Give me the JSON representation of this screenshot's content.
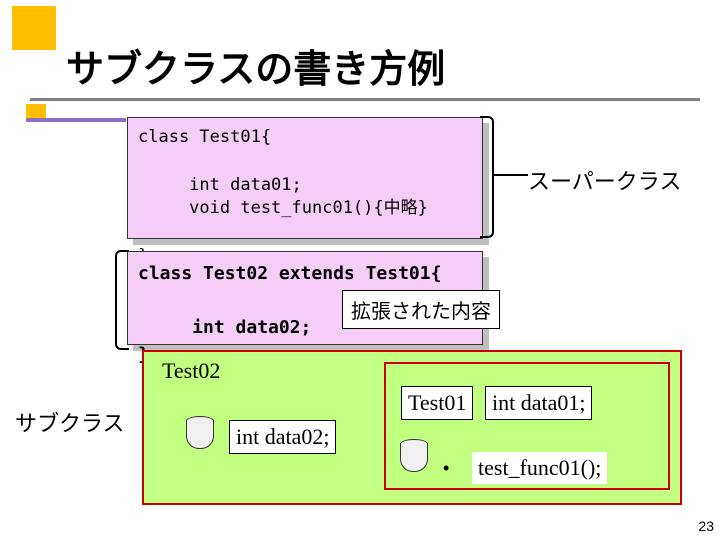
{
  "title": "サブクラスの書き方例",
  "code1": "class Test01{\n\n     int data01;\n     void test_func01(){中略}\n\n}",
  "code2": "class Test02 extends Test01{\n\n     int data02;\n}",
  "labels": {
    "superclass": "スーパークラス",
    "subclass": "サブクラス",
    "extended": "拡張された内容"
  },
  "boxes": {
    "test02": "Test02",
    "test01": "Test01",
    "data01": "int data01;",
    "data02": "int data02;",
    "func01": "test_func01();"
  },
  "page": "23"
}
